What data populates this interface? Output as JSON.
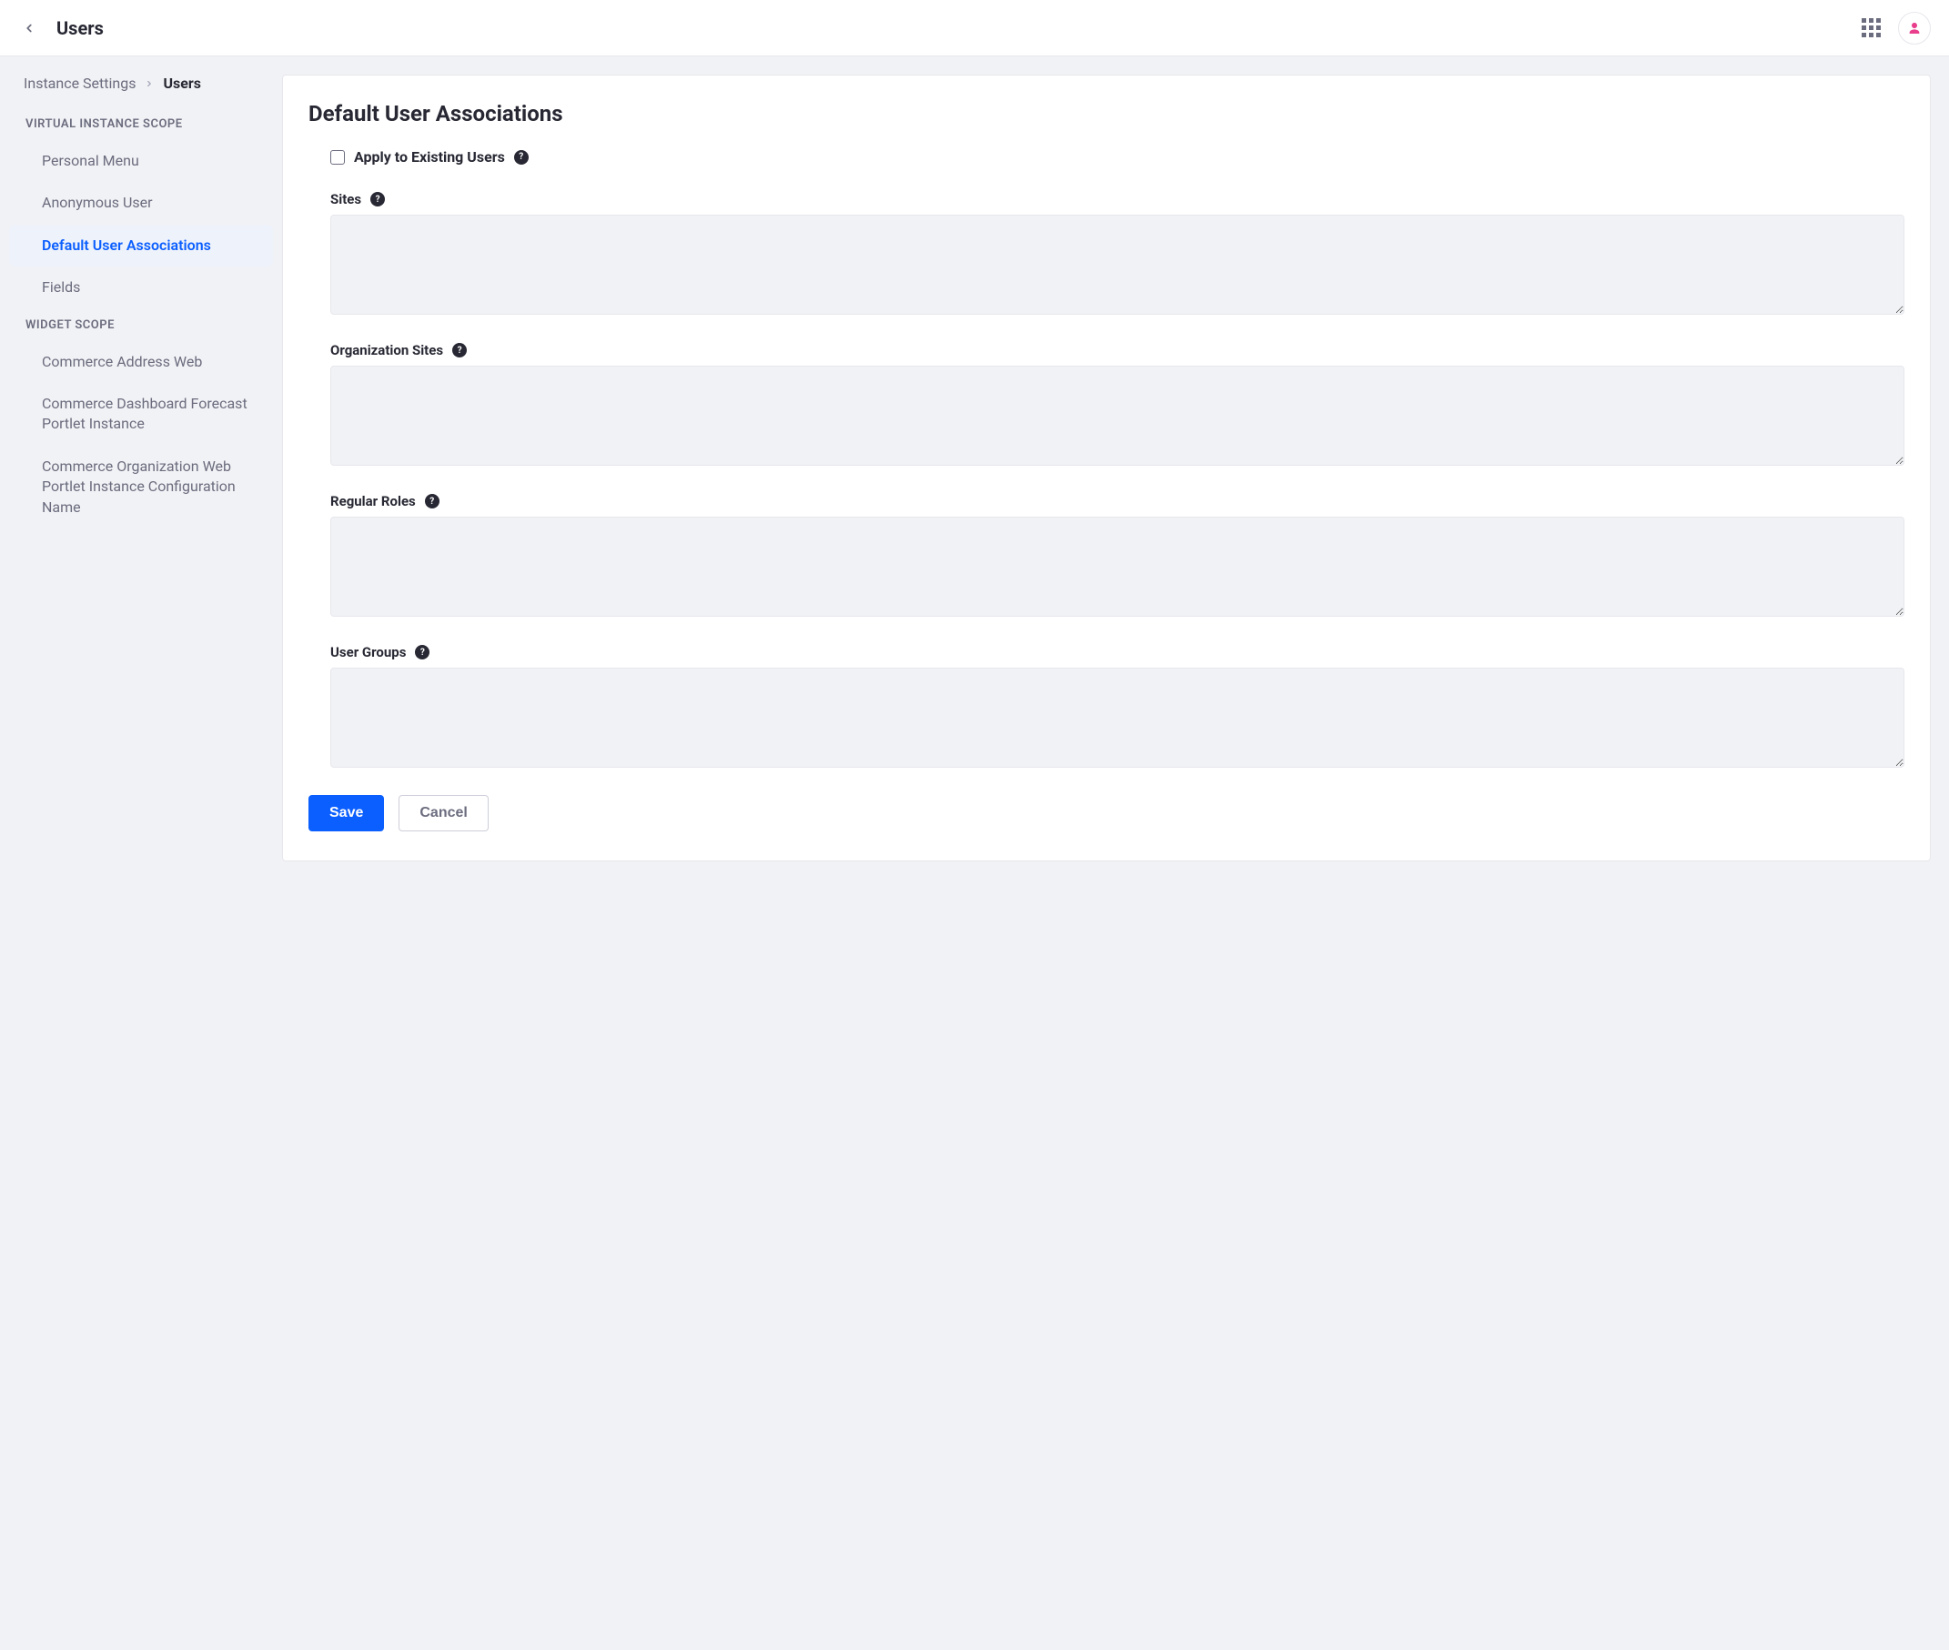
{
  "topbar": {
    "title": "Users"
  },
  "breadcrumb": {
    "parent": "Instance Settings",
    "current": "Users"
  },
  "sidebar": {
    "section1_title": "VIRTUAL INSTANCE SCOPE",
    "section1_items": [
      "Personal Menu",
      "Anonymous User",
      "Default User Associations",
      "Fields"
    ],
    "section1_active_index": 2,
    "section2_title": "WIDGET SCOPE",
    "section2_items": [
      "Commerce Address Web",
      "Commerce Dashboard Forecast Portlet Instance",
      "Commerce Organization Web Portlet Instance Configuration Name"
    ]
  },
  "form": {
    "title": "Default User Associations",
    "apply_label": "Apply to Existing Users",
    "apply_checked": false,
    "fields": {
      "sites": {
        "label": "Sites",
        "value": ""
      },
      "org_sites": {
        "label": "Organization Sites",
        "value": ""
      },
      "regular_roles": {
        "label": "Regular Roles",
        "value": ""
      },
      "user_groups": {
        "label": "User Groups",
        "value": ""
      }
    },
    "save_label": "Save",
    "cancel_label": "Cancel"
  }
}
